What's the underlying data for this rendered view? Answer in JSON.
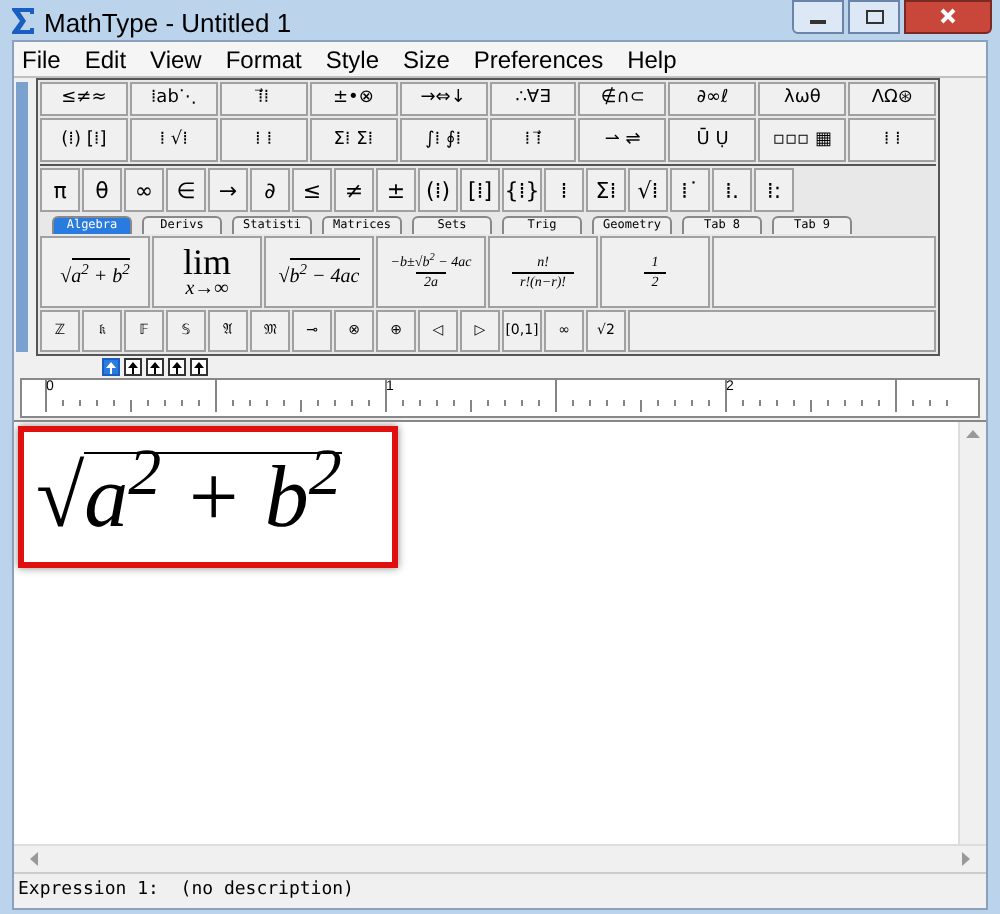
{
  "window": {
    "title": "MathType - Untitled 1"
  },
  "menu": [
    "File",
    "Edit",
    "View",
    "Format",
    "Style",
    "Size",
    "Preferences",
    "Help"
  ],
  "palettes": [
    [
      "≤≠≈",
      "⁞ab⋱",
      "⁞⃗⁞",
      "±•⊗",
      "→⇔↓",
      "∴∀∃",
      "∉∩⊂",
      "∂∞ℓ",
      "λωθ",
      "ΛΩ⊛"
    ],
    [
      "(⁞) [⁞]",
      "⁞ √⁞",
      "⁞ ⁞",
      "Σ⁞ Σ⁞",
      "∫⁞ ∮⁞",
      "⁞ ⁞⃗",
      "⇀ ⇌",
      "Ū Ụ",
      "▫▫▫ ▦",
      "⁞ ⁞"
    ]
  ],
  "symbols": [
    "π",
    "θ",
    "∞",
    "∈",
    "→",
    "∂",
    "≤",
    "≠",
    "±",
    "(⁞)",
    "[⁞]",
    "{⁞}",
    "⁞",
    "Σ⁞",
    "√⁞",
    "⁞˙",
    "⁞.",
    "⁞:"
  ],
  "tabs": [
    {
      "label": "Algebra",
      "selected": true
    },
    {
      "label": "Derivs",
      "selected": false
    },
    {
      "label": "Statisti",
      "selected": false
    },
    {
      "label": "Matrices",
      "selected": false
    },
    {
      "label": "Sets",
      "selected": false
    },
    {
      "label": "Trig",
      "selected": false
    },
    {
      "label": "Geometry",
      "selected": false
    },
    {
      "label": "Tab 8",
      "selected": false
    },
    {
      "label": "Tab 9",
      "selected": false
    }
  ],
  "templates": [
    {
      "kind": "sqrt",
      "radical": "√",
      "radicand": "a$^{2}$ + b$^{2}$"
    },
    {
      "kind": "limit",
      "top": "lim",
      "bottom": "x→∞"
    },
    {
      "kind": "sqrt",
      "radical": "√",
      "radicand": "b$^{2}$ − 4ac"
    },
    {
      "kind": "fraction",
      "numerator": "−b±√b$^{2}$ − 4ac",
      "denominator": "2a"
    },
    {
      "kind": "fraction",
      "numerator": "n!",
      "denominator": "r!(n−r)!"
    },
    {
      "kind": "fraction",
      "numerator": "1",
      "denominator": "2"
    }
  ],
  "bottom_symbols": [
    "ℤ",
    "𝔨",
    "𝔽",
    "𝕊",
    "𝔄",
    "𝔐",
    "⊸",
    "⊗",
    "⊕",
    "◁",
    "▷",
    "[0,1]",
    "∞",
    "√2"
  ],
  "nudge_buttons": [
    {
      "selected": true
    },
    {
      "selected": false
    },
    {
      "selected": false
    },
    {
      "selected": false
    },
    {
      "selected": false
    }
  ],
  "ruler": [
    "0",
    "1",
    "2"
  ],
  "expression": {
    "radical": "√",
    "radicand": "a$^{2}$ + b$^{2}$"
  },
  "status_bar": "Expression 1:  (no description)"
}
